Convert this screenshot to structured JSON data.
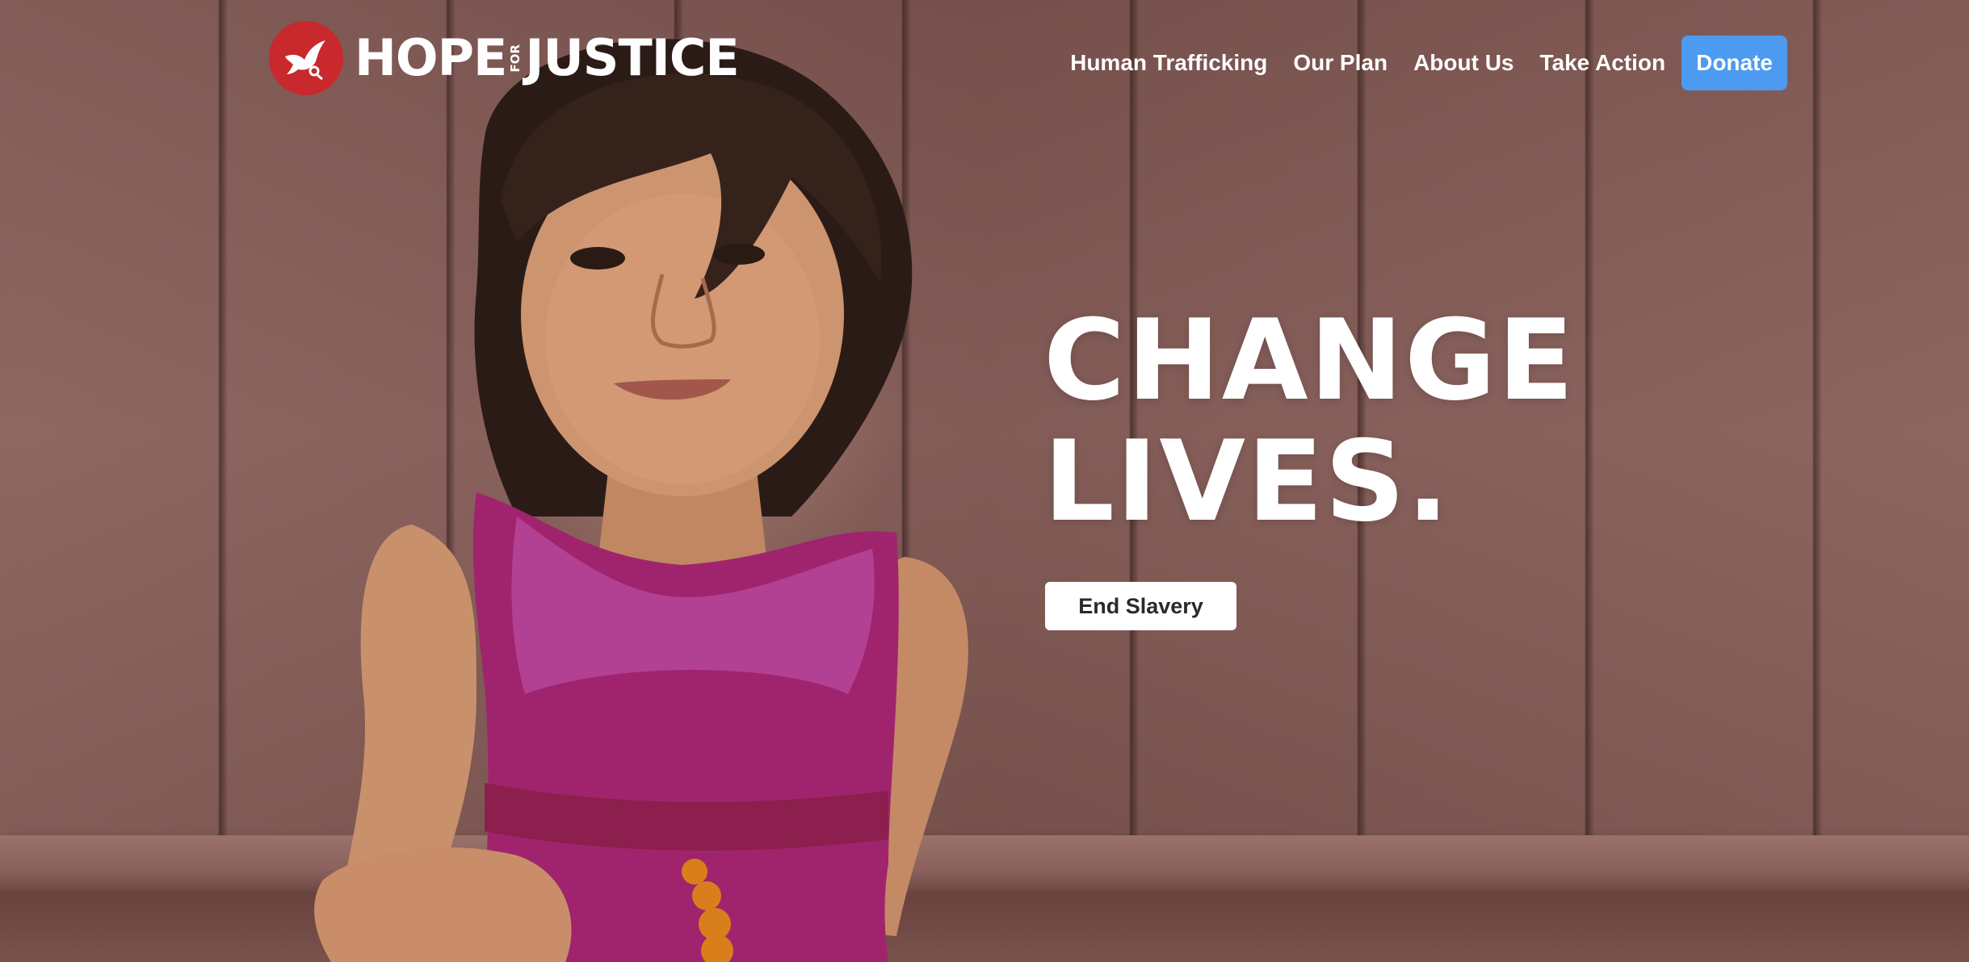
{
  "brand": {
    "name_part1": "HOPE",
    "name_small": "FOR",
    "name_part2": "JUSTICE",
    "logo_icon": "dove-icon",
    "logo_color": "#c9282d"
  },
  "nav": {
    "items": [
      {
        "label": "Human Trafficking"
      },
      {
        "label": "Our Plan"
      },
      {
        "label": "About Us"
      },
      {
        "label": "Take Action"
      }
    ],
    "donate_label": "Donate",
    "donate_color": "#4c9bf0"
  },
  "hero": {
    "headline_line1": "CHANGE",
    "headline_line2": "LIVES.",
    "cta_label": "End Slavery"
  }
}
